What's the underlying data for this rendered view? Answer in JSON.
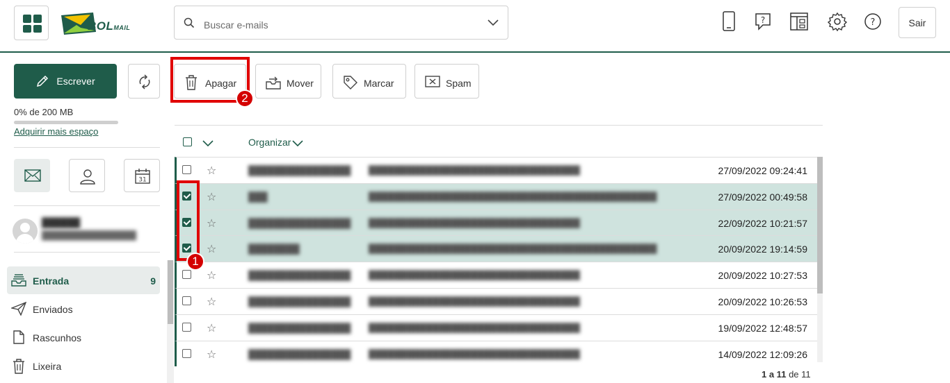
{
  "header": {
    "logo_text": "BOL",
    "logo_sub": "MAIL",
    "search_placeholder": "Buscar e-mails",
    "exit_label": "Sair",
    "icons": [
      "grid-icon",
      "mobile-icon",
      "help-chat-icon",
      "layout-icon",
      "gear-icon",
      "question-icon"
    ]
  },
  "sidebar": {
    "compose_label": "Escrever",
    "quota_text": "0% de 200 MB",
    "quota_fraction": 0.0,
    "buy_space_link": "Adquirir mais espaço",
    "apps": [
      "mail-icon",
      "contacts-icon",
      "calendar-icon"
    ],
    "calendar_day": "31",
    "folders": [
      {
        "label": "Entrada",
        "count": "9",
        "icon": "inbox-icon"
      },
      {
        "label": "Enviados",
        "count": "",
        "icon": "send-icon"
      },
      {
        "label": "Rascunhos",
        "count": "",
        "icon": "draft-icon"
      },
      {
        "label": "Lixeira",
        "count": "",
        "icon": "trash-icon"
      }
    ]
  },
  "toolbar": {
    "delete_label": "Apagar",
    "move_label": "Mover",
    "tag_label": "Marcar",
    "spam_label": "Spam"
  },
  "annotations": {
    "badge_1": "1",
    "badge_2": "2"
  },
  "list": {
    "sort_label": "Organizar",
    "rows": [
      {
        "date": "27/09/2022 09:24:41",
        "selected": false
      },
      {
        "date": "27/09/2022 00:49:58",
        "selected": true
      },
      {
        "date": "22/09/2022 10:21:57",
        "selected": true
      },
      {
        "date": "20/09/2022 19:14:59",
        "selected": true
      },
      {
        "date": "20/09/2022 10:27:53",
        "selected": false
      },
      {
        "date": "20/09/2022 10:26:53",
        "selected": false
      },
      {
        "date": "19/09/2022 12:48:57",
        "selected": false
      },
      {
        "date": "14/09/2022 12:09:26",
        "selected": false
      }
    ],
    "pager": {
      "range": "1 a 11",
      "of": "de",
      "total": "11"
    }
  },
  "colors": {
    "brand": "#1f5c4a",
    "selected_row": "#cfe3de",
    "annotation_red": "#e00000"
  }
}
